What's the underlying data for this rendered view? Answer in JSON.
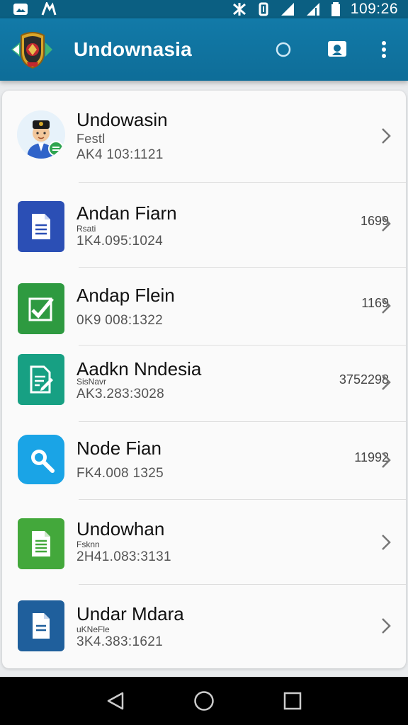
{
  "status_bar": {
    "time": "109:26"
  },
  "app_bar": {
    "title": "Undownasia"
  },
  "rows": [
    {
      "title": "Undowasin",
      "sub": "Festl",
      "code": "AK4 103:1121",
      "value": ""
    },
    {
      "title": "Andan Fiarn",
      "sub": "Rsati",
      "code": "1K4.095:1024",
      "value": "1699"
    },
    {
      "title": "Andap Flein",
      "sub": "",
      "code": "0K9 008:1322",
      "value": "1169"
    },
    {
      "title": "Aadkn Nndesia",
      "sub": "SisNavr",
      "code": "AK3.283:3028",
      "value": "3752298"
    },
    {
      "title": "Node Fian",
      "sub": "",
      "code": "FK4.008 1325",
      "value": "11992"
    },
    {
      "title": "Undowhan",
      "sub": "Fsknn",
      "code": "2H41.083:3131",
      "value": ""
    },
    {
      "title": "Undar Mdara",
      "sub": "uKNeFle",
      "code": "3K4.383:1621",
      "value": ""
    }
  ],
  "colors": {
    "app_bar": "#127aa8",
    "status_bar": "#0b5f82",
    "doc_blue": "#2b4fb5",
    "check_green": "#2e9a40",
    "doc_teal": "#17a083",
    "search_blue": "#1aa4e6",
    "sheet_green": "#43a83b",
    "doc_navy": "#1f5f9c"
  },
  "icons": [
    "app-logo",
    "search-icon",
    "id-card-icon",
    "more-vert-icon",
    "avatar",
    "document-icon",
    "checkmark-icon",
    "edit-document-icon",
    "magnifier-icon",
    "spreadsheet-icon",
    "file-icon",
    "back-icon",
    "home-icon",
    "recents-icon"
  ]
}
